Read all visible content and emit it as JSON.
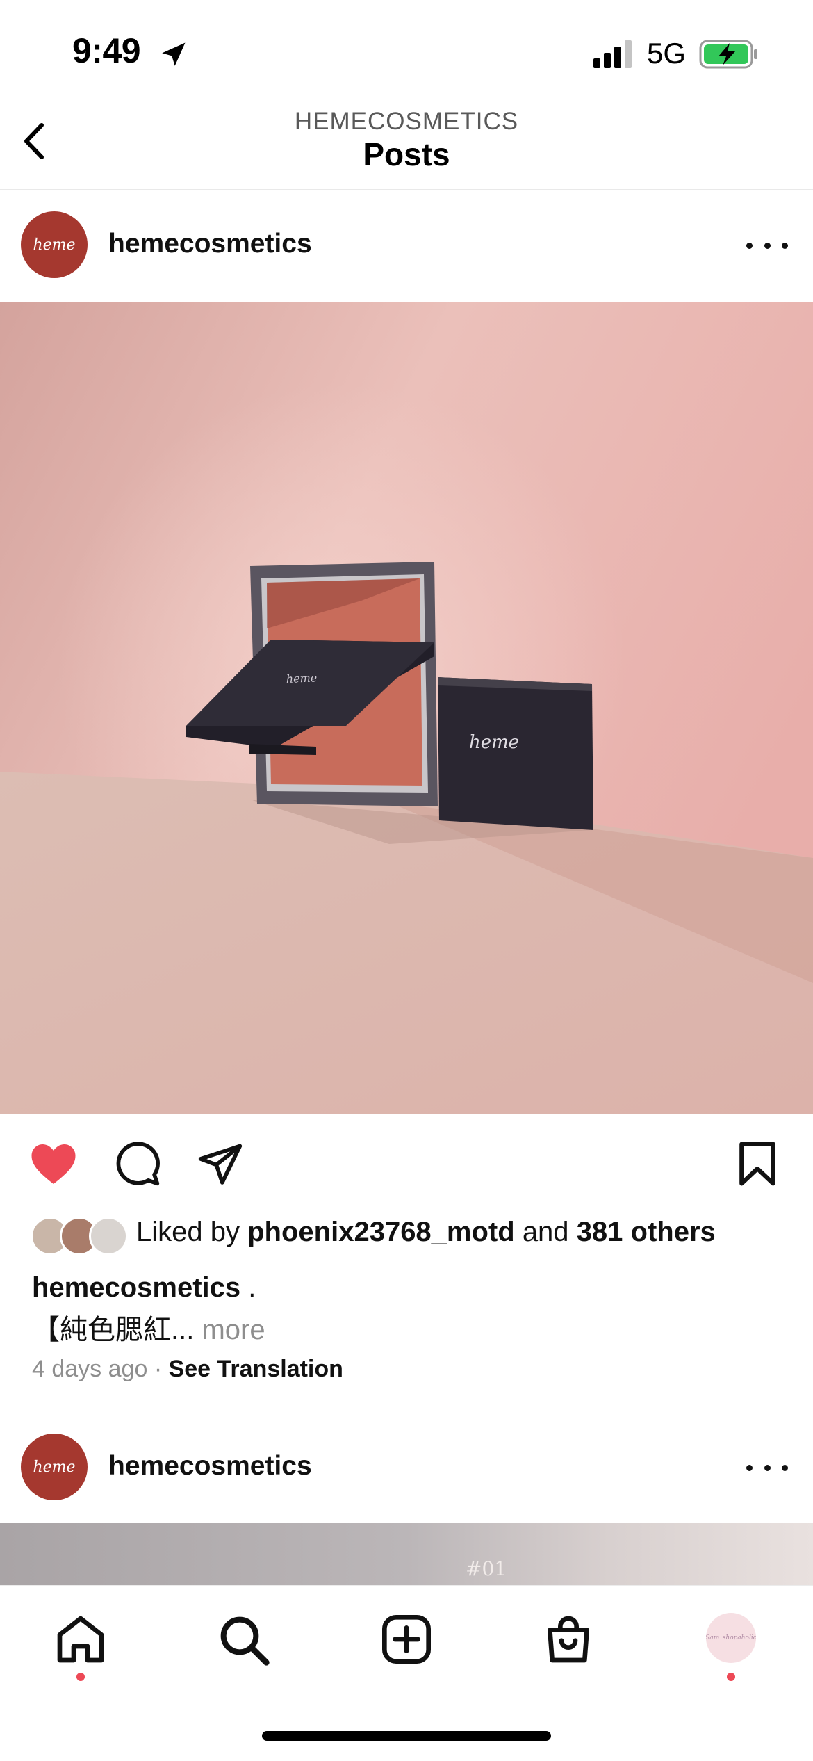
{
  "status_bar": {
    "time": "9:49",
    "network": "5G",
    "battery_charging": true
  },
  "header": {
    "account": "HEMECOSMETICS",
    "title": "Posts"
  },
  "posts": [
    {
      "avatar_text": "heme",
      "username": "hemecosmetics",
      "photo_brand_text": "heme",
      "liked_by_prefix": "Liked by",
      "liked_by_user": "phoenix23768_motd",
      "liked_by_join": "and",
      "liked_by_others": "381 others",
      "caption_user": "hemecosmetics",
      "caption_suffix": " .",
      "caption_text": "【純色腮紅...",
      "caption_more": "more",
      "time_ago": "4 days ago",
      "separator": "·",
      "see_translation": "See Translation"
    },
    {
      "avatar_text": "heme",
      "username": "hemecosmetics",
      "photo_tag": "#01"
    }
  ],
  "tab_bar": {
    "items": [
      "home-tab",
      "search-tab",
      "create-tab",
      "shop-tab",
      "profile-tab"
    ],
    "profile_avatar_text": "Sam_shopaholic"
  },
  "colors": {
    "like_red": "#ed4956",
    "avatar_brand": "#a5382f",
    "photo_bg": "#e8b7b1"
  }
}
